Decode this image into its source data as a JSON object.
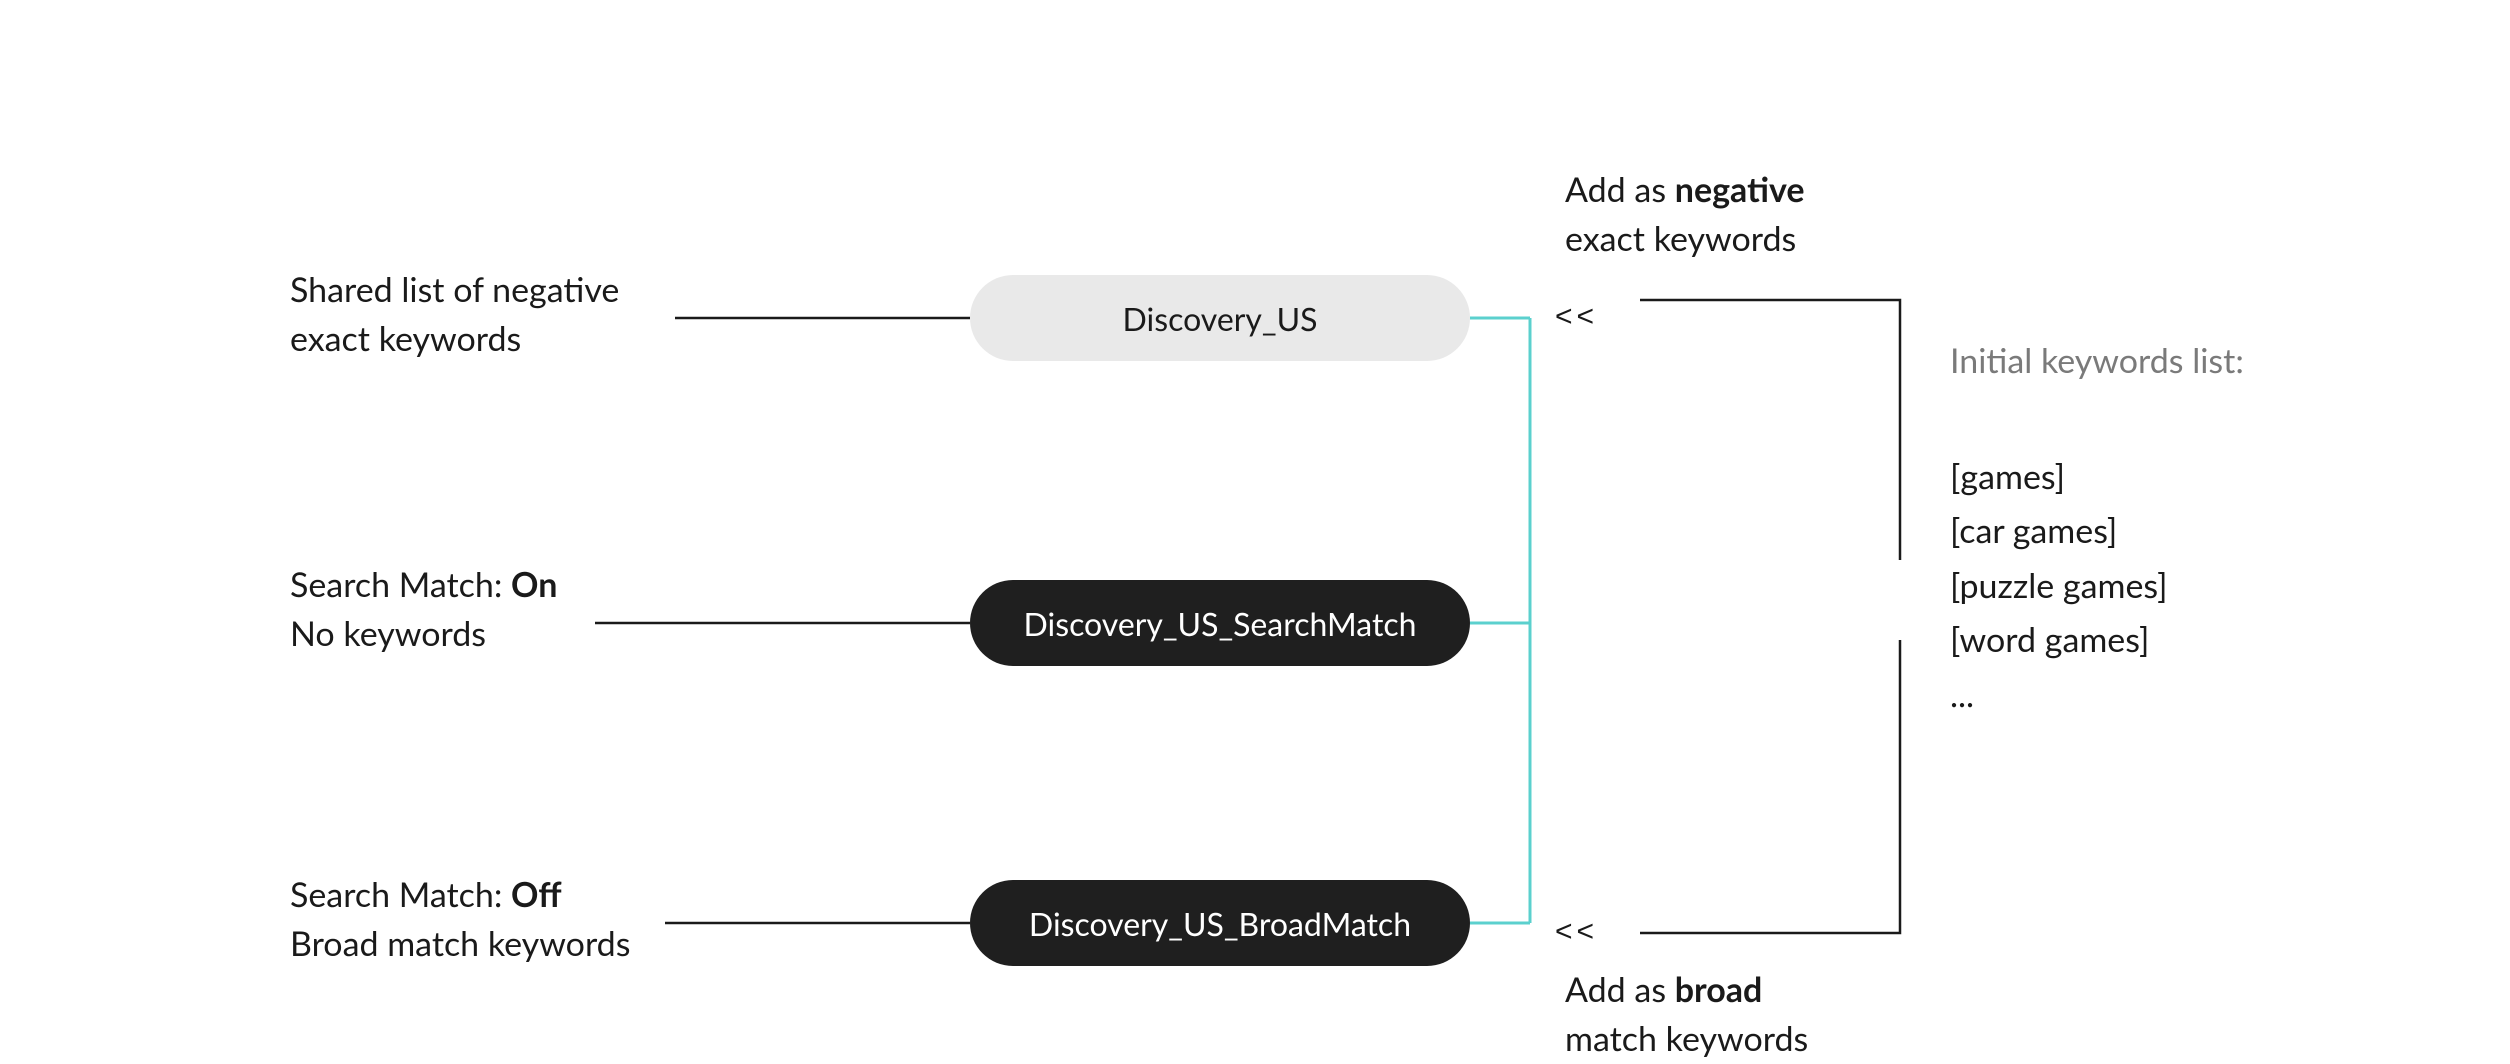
{
  "descriptions": {
    "row1_line1": "Shared list of negative",
    "row1_line2": "exact keywords",
    "row2_line1_pre": "Search Match: ",
    "row2_line1_bold": "On",
    "row2_line2": "No keywords",
    "row3_line1_pre": "Search Match: ",
    "row3_line1_bold": "Off",
    "row3_line2": "Broad match keywords"
  },
  "pills": {
    "row1": "Discovery_US",
    "row2": "Discovery_US_SearchMatch",
    "row3": "Discovery_US_BroadMatch"
  },
  "annotations": {
    "top_line1_pre": "Add as ",
    "top_line1_bold": "negative",
    "top_line2": "exact keywords",
    "bottom_line1_pre": "Add as ",
    "bottom_line1_bold": "broad",
    "bottom_line2": "match keywords"
  },
  "keywords": {
    "title": "Initial keywords list:",
    "items": [
      "[games]",
      "[car games]",
      "[puzzle games]",
      "[word games]",
      "..."
    ]
  },
  "chevrons": {
    "top": "<<",
    "bottom": "<<"
  }
}
